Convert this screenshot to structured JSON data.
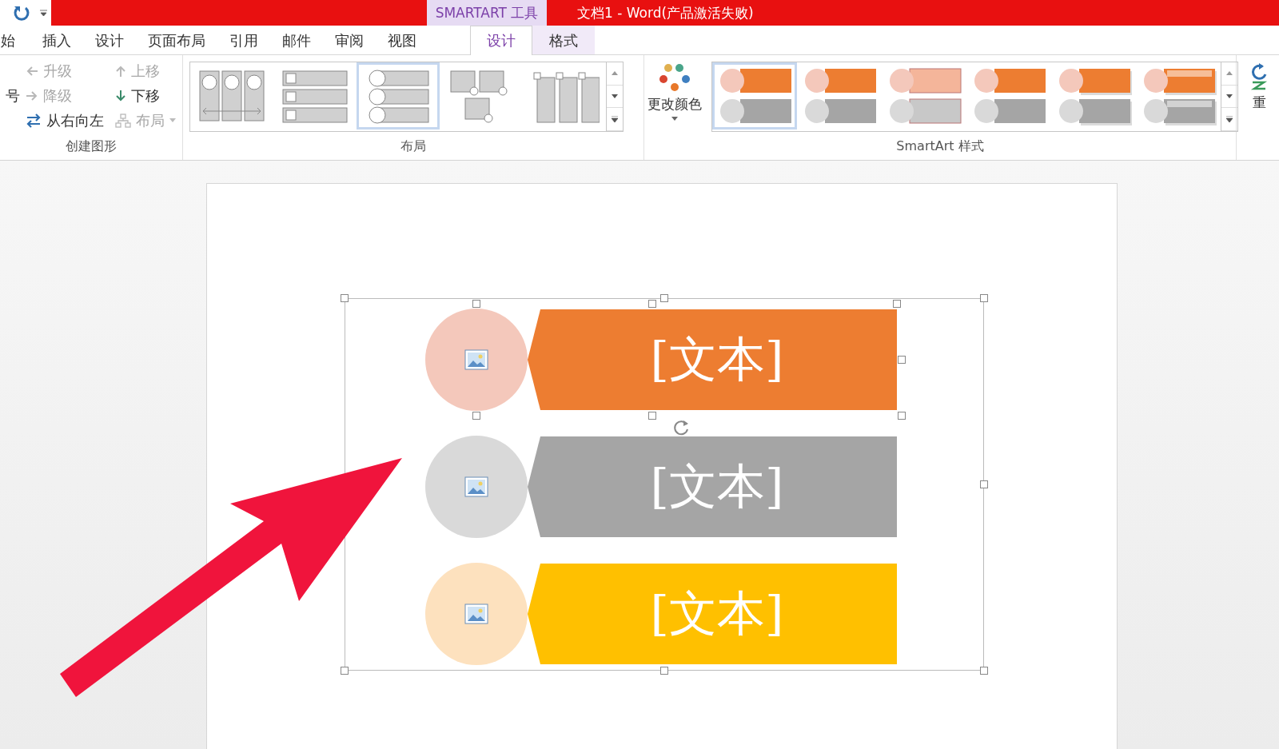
{
  "title_bar": {
    "contextual_label": "SMARTART 工具",
    "title": "文档1 -  Word(产品激活失败)"
  },
  "tabs": [
    {
      "label": "始",
      "selected": false,
      "contextual": false
    },
    {
      "label": "插入",
      "selected": false,
      "contextual": false
    },
    {
      "label": "设计",
      "selected": false,
      "contextual": false
    },
    {
      "label": "页面布局",
      "selected": false,
      "contextual": false
    },
    {
      "label": "引用",
      "selected": false,
      "contextual": false
    },
    {
      "label": "邮件",
      "selected": false,
      "contextual": false
    },
    {
      "label": "审阅",
      "selected": false,
      "contextual": false
    },
    {
      "label": "视图",
      "selected": false,
      "contextual": false
    },
    {
      "label": "设计",
      "selected": true,
      "contextual": true
    },
    {
      "label": "格式",
      "selected": false,
      "contextual": true
    }
  ],
  "create_group": {
    "label": "创建图形",
    "cut_button": "号",
    "commands": [
      {
        "kind": "promote",
        "label": "升级",
        "disabled": true
      },
      {
        "kind": "move_up",
        "label": "上移",
        "disabled": true
      },
      {
        "kind": "demote",
        "label": "降级",
        "disabled": true
      },
      {
        "kind": "move_down",
        "label": "下移",
        "disabled": false
      },
      {
        "kind": "right_to_left",
        "label": "从右向左",
        "disabled": false
      },
      {
        "kind": "layout",
        "label": "布局",
        "disabled": true
      }
    ]
  },
  "layout_group": {
    "label": "布局",
    "layouts": [
      {
        "kind": "columns",
        "selected": false
      },
      {
        "kind": "list",
        "selected": false
      },
      {
        "kind": "circles",
        "selected": true
      },
      {
        "kind": "pictures",
        "selected": false
      },
      {
        "kind": "tall",
        "selected": false
      }
    ]
  },
  "change_colors": {
    "label": "更改颜色"
  },
  "styles_group": {
    "label": "SmartArt 样式",
    "styles": [
      {
        "kind": "flat",
        "selected": true
      },
      {
        "kind": "flat",
        "selected": false
      },
      {
        "kind": "outline",
        "selected": false
      },
      {
        "kind": "gradient",
        "selected": false
      },
      {
        "kind": "shadow",
        "selected": false
      },
      {
        "kind": "glossy",
        "selected": false
      }
    ]
  },
  "reset_button": {
    "label": "重"
  },
  "diagram": {
    "items": [
      {
        "text": "[文本]",
        "color": "#ed7d31",
        "circle": {
          "color": "#f4c8bb"
        },
        "selected": true
      },
      {
        "text": "[文本]",
        "color": "#a5a5a5",
        "circle": {
          "color": "#d9d9d9"
        },
        "selected": false
      },
      {
        "text": "[文本]",
        "color": "#ffc000",
        "circle": {
          "color": "#fde1be"
        },
        "selected": false
      }
    ]
  }
}
